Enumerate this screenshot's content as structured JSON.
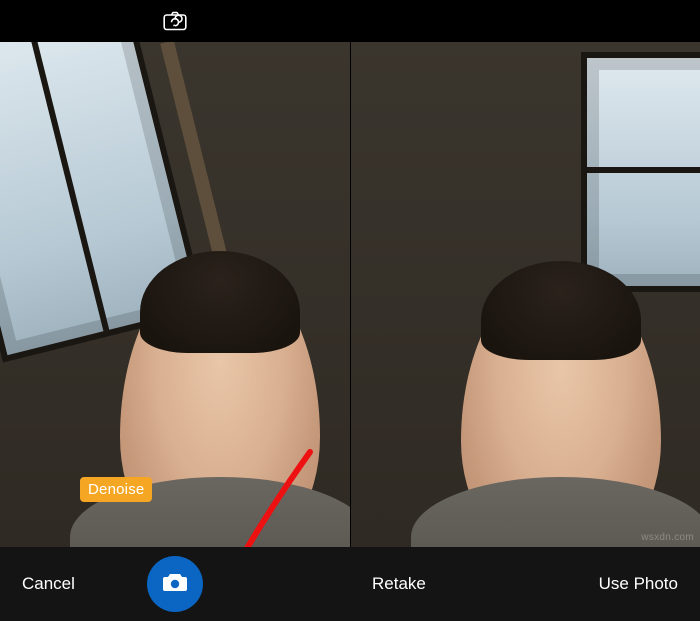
{
  "topbar": {
    "flip_icon_name": "camera-flip-icon"
  },
  "left_pane": {
    "badge_text": "Denoise"
  },
  "bottom": {
    "cancel_label": "Cancel",
    "retake_label": "Retake",
    "use_photo_label": "Use Photo"
  },
  "annotation": {
    "arrow_color": "#e11"
  },
  "watermark": "wsxdn.com"
}
